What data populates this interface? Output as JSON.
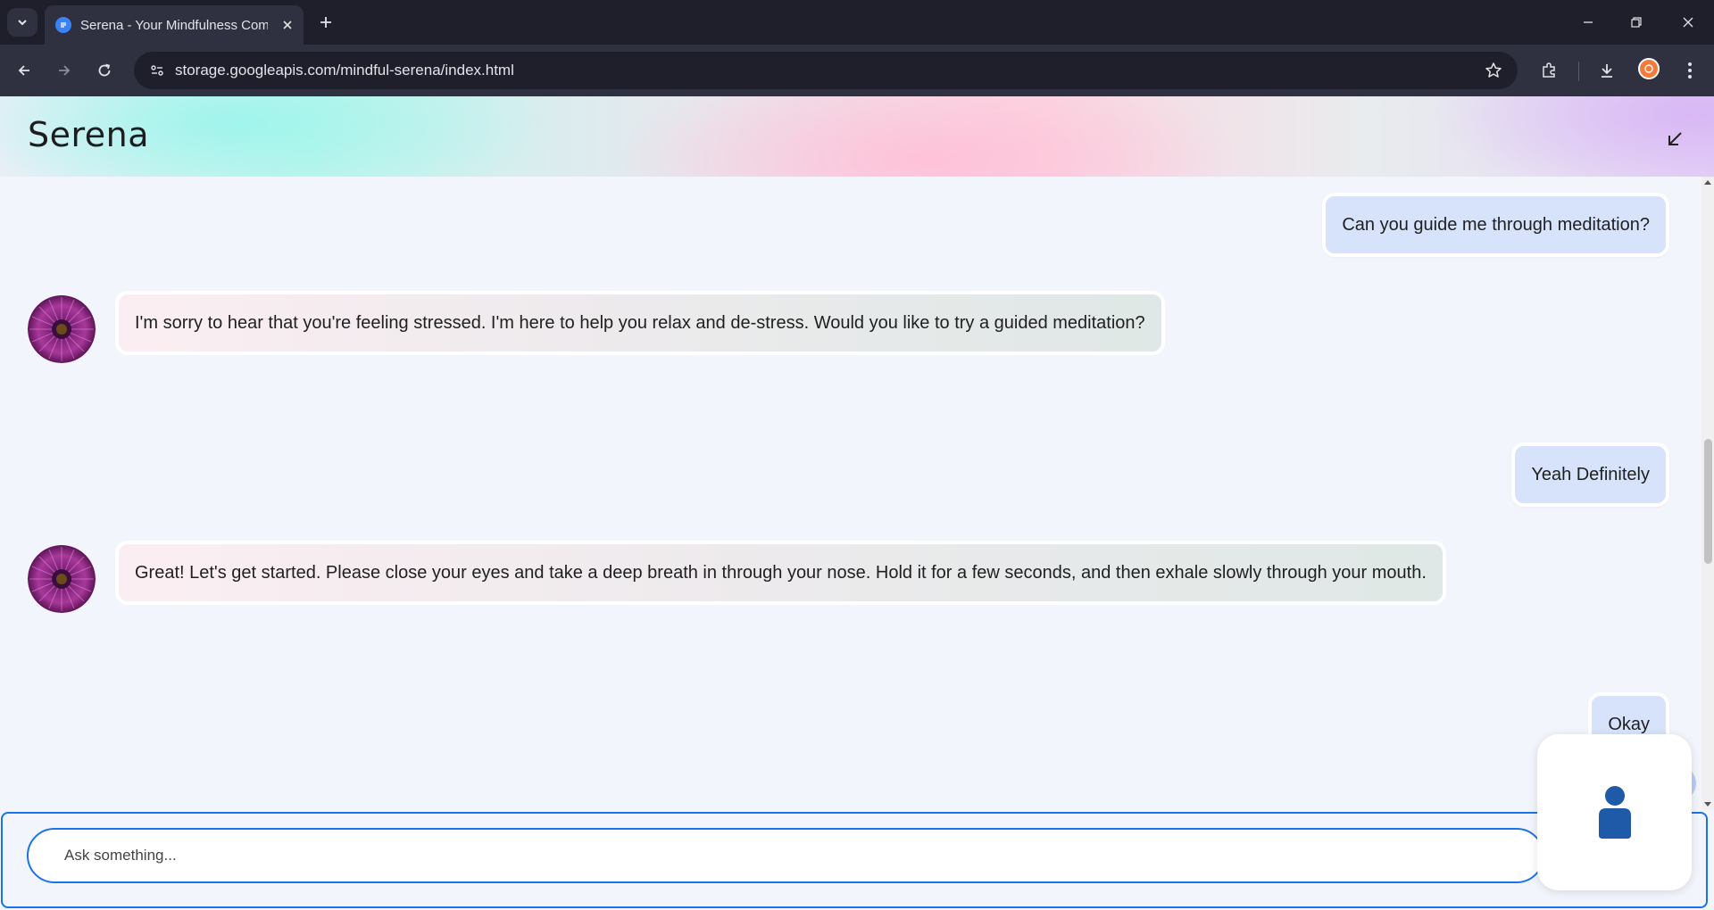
{
  "browser": {
    "tab_title": "Serena - Your Mindfulness Com",
    "url": "storage.googleapis.com/mindful-serena/index.html"
  },
  "app": {
    "title": "Serena"
  },
  "messages": [
    {
      "role": "user",
      "text": "Can you guide me through meditation?"
    },
    {
      "role": "assistant",
      "text": "I'm sorry to hear that you're feeling stressed. I'm here to help you relax and de-stress. Would you like to try a guided meditation?"
    },
    {
      "role": "user",
      "text": "Yeah Definitely"
    },
    {
      "role": "assistant",
      "text": "Great! Let's get started. Please close your eyes and take a deep breath in through your nose. Hold it for a few seconds, and then exhale slowly through your mouth."
    },
    {
      "role": "user",
      "text": "Okay"
    }
  ],
  "input": {
    "placeholder": "Ask something..."
  },
  "colors": {
    "accent": "#1a73e8",
    "user_bubble": "#d7e3fa",
    "voice_icon": "#1e5aa8"
  }
}
